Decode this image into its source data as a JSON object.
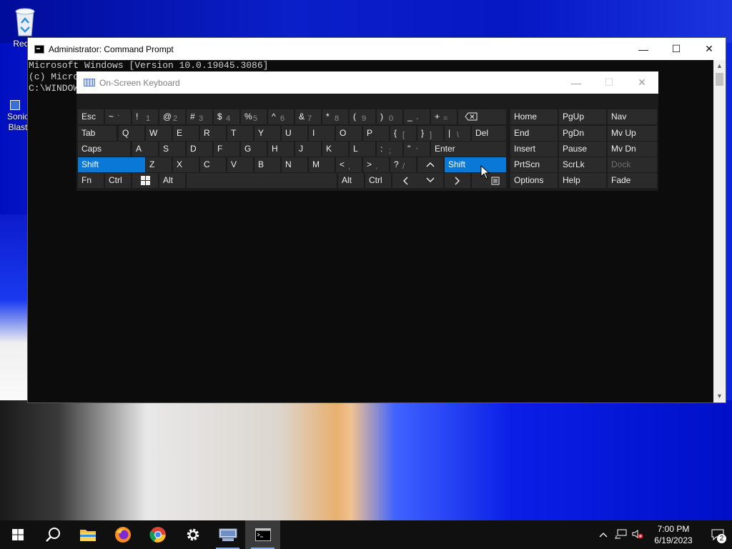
{
  "desktop": {
    "icons": [
      {
        "label": "Recyc"
      },
      {
        "label": "Sonic Blast"
      }
    ]
  },
  "cmd": {
    "title": "Administrator: Command Prompt",
    "lines": [
      "Microsoft Windows [Version 10.0.19045.3086]",
      "(c) Micro",
      "",
      "C:\\WINDOW"
    ]
  },
  "osk": {
    "title": "On-Screen Keyboard",
    "keys": {
      "esc": "Esc",
      "tab": "Tab",
      "caps": "Caps",
      "lshift": "Shift",
      "fn": "Fn",
      "lctrl": "Ctrl",
      "lalt": "Alt",
      "ralt": "Alt",
      "rctrl": "Ctrl",
      "del": "Del",
      "enter": "Enter",
      "rshift": "Shift",
      "tilde": "~",
      "tilde_sub": "`",
      "n1": "!",
      "n1_sub": "1",
      "n2": "@",
      "n2_sub": "2",
      "n3": "#",
      "n3_sub": "3",
      "n4": "$",
      "n4_sub": "4",
      "n5": "%",
      "n5_sub": "5",
      "n6": "^",
      "n6_sub": "6",
      "n7": "&",
      "n7_sub": "7",
      "n8": "*",
      "n8_sub": "8",
      "n9": "(",
      "n9_sub": "9",
      "n0": ")",
      "n0_sub": "0",
      "minus": "_",
      "minus_sub": "-",
      "equal": "+",
      "equal_sub": "=",
      "q": "Q",
      "w": "W",
      "e": "E",
      "r": "R",
      "t": "T",
      "y": "Y",
      "u": "U",
      "i": "I",
      "o": "O",
      "p": "P",
      "lbrace": "{",
      "lbrace_sub": "[",
      "rbrace": "}",
      "rbrace_sub": "]",
      "pipe": "|",
      "pipe_sub": "\\",
      "a": "A",
      "s": "S",
      "d": "D",
      "f": "F",
      "g": "G",
      "h": "H",
      "j": "J",
      "k": "K",
      "l": "L",
      "colon": ":",
      "colon_sub": ";",
      "quote": "\"",
      "quote_sub": "'",
      "z": "Z",
      "x": "X",
      "c": "C",
      "v": "V",
      "b": "B",
      "n": "N",
      "m": "M",
      "lt": "<",
      "lt_sub": ",",
      "gt": ">",
      "gt_sub": ".",
      "qmark": "?",
      "qmark_sub": "/",
      "home": "Home",
      "pgup": "PgUp",
      "nav": "Nav",
      "end": "End",
      "pgdn": "PgDn",
      "mvup": "Mv Up",
      "insert": "Insert",
      "pause": "Pause",
      "mvdn": "Mv Dn",
      "prtscn": "PrtScn",
      "scrlk": "ScrLk",
      "dock": "Dock",
      "options": "Options",
      "help": "Help",
      "fade": "Fade"
    }
  },
  "tray": {
    "time": "7:00 PM",
    "date": "6/19/2023",
    "notification_count": "2"
  },
  "colors": {
    "accent": "#0a78d7",
    "key_bg": "#2b2b2b",
    "osk_bg": "#1c1c1c",
    "taskbar": "#101010"
  }
}
